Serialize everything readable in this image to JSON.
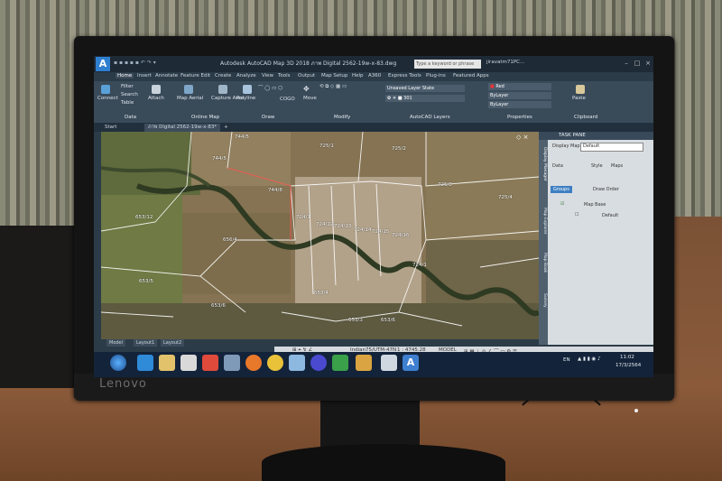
{
  "window": {
    "app_icon": "A",
    "title": "Autodesk AutoCAD Map 3D 2018   ภาพ Digital 2562-19w-x-83.dwg",
    "search_placeholder": "Type a keyword or phrase",
    "user": "jiravatm71PC..."
  },
  "ribbon_tabs": [
    "Home",
    "Insert",
    "Annotate",
    "Feature Edit",
    "Create",
    "Analyze",
    "View",
    "Tools",
    "Output",
    "Map Setup",
    "Help",
    "A360",
    "Express Tools",
    "Plug-ins",
    "Featured Apps"
  ],
  "ribbon": {
    "connect": "Connect",
    "filter": "Filter",
    "search": "Search",
    "table": "Table",
    "attach": "Attach",
    "map_aerial": "Map Aerial",
    "capture_area": "Capture Area",
    "polyline": "Polyline",
    "cogo": "COGO",
    "move": "Move",
    "layer_state": "Unsaved Layer State",
    "layer_name": "301",
    "color": "Red",
    "linetype": "ByLayer",
    "lineweight": "ByLayer",
    "paste": "Paste",
    "groups": [
      "Data",
      "Online Map",
      "Draw",
      "Modify",
      "AutoCAD Layers",
      "Properties",
      "Clipboard"
    ]
  },
  "doc_tabs": [
    "Start",
    "ภาพ Digital 2562-19w-x-83*"
  ],
  "parcels": [
    "744/5",
    "744/8",
    "725/1",
    "725/2",
    "725/3",
    "725/4",
    "744/9",
    "724/1",
    "724/12",
    "724/13",
    "724/14",
    "724/15",
    "724/16",
    "653/12",
    "656/4",
    "653/5",
    "653/4",
    "653/3",
    "653/6",
    "653/1",
    "724/1"
  ],
  "task_pane": {
    "title": "TASK PANE",
    "display_map_label": "Display Map:",
    "display_map_value": "Default",
    "tools": [
      "Data",
      "Style",
      "Maps"
    ],
    "groups_btn": "Groups",
    "draw_order": "Draw Order",
    "tree_root": "Map Base",
    "tree_child": "Default",
    "side_tabs": [
      "Display Manager",
      "Map Explorer",
      "Map Book",
      "Survey"
    ]
  },
  "layout_tabs": [
    "Model",
    "Layout1",
    "Layout2"
  ],
  "status": {
    "coord_system": "Indian75/UTM-47N",
    "scale": "1 : 4745.28",
    "model": "MODEL"
  },
  "taskbar": {
    "lang": "EN",
    "time": "11:02",
    "date": "17/3/2564"
  },
  "bezel": {
    "brand": "Lenovo"
  }
}
